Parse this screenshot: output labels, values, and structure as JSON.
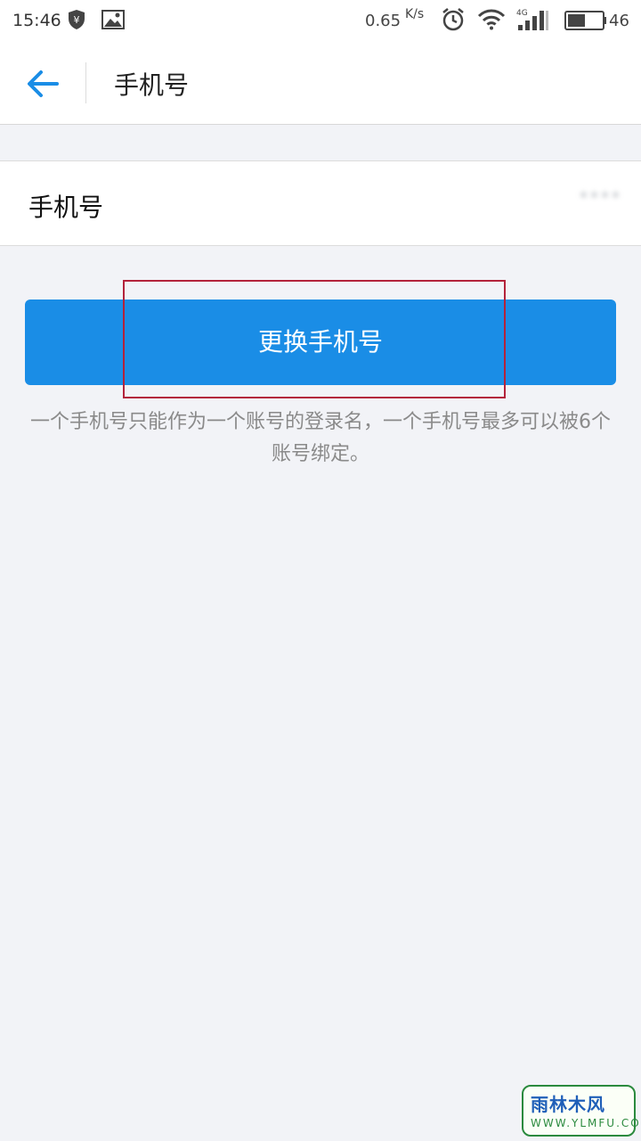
{
  "status_bar": {
    "time": "15:46",
    "net_speed": "0.65",
    "net_speed_unit": "K/s",
    "network_type": "4G",
    "battery_level": "46",
    "icons": [
      "shield-yen-icon",
      "image-icon",
      "alarm-icon",
      "wifi-icon",
      "signal-icon",
      "battery-icon"
    ]
  },
  "header": {
    "title": "手机号"
  },
  "phone_row": {
    "label": "手机号",
    "value": "****"
  },
  "main": {
    "change_button_label": "更换手机号",
    "hint": "一个手机号只能作为一个账号的登录名，一个手机号最多可以被6个账号绑定。"
  },
  "watermark": {
    "main": "雨林木风",
    "sub": "WWW.YLMFU.COM"
  },
  "colors": {
    "accent": "#1a8de6",
    "background": "#f2f3f7",
    "highlight": "#b3233b"
  }
}
